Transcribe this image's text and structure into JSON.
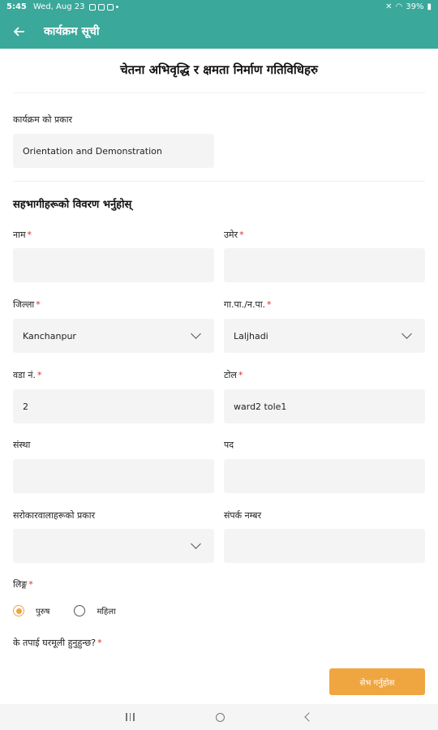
{
  "status_bar": {
    "time": "5:45",
    "date": "Wed, Aug 23",
    "battery": "39%"
  },
  "app_bar": {
    "title": "कार्यक्रम सूची"
  },
  "page": {
    "heading": "चेतना अभिवृद्धि र क्षमता निर्माण गतिविधिहरु"
  },
  "program_type": {
    "label": "कार्यक्रम को प्रकार",
    "value": "Orientation and Demonstration"
  },
  "section_title": "सहभागीहरूको विवरण भर्नुहोस्",
  "fields": {
    "name": {
      "label": "नाम",
      "value": ""
    },
    "age": {
      "label": "उमेर",
      "value": ""
    },
    "district": {
      "label": "जिल्ला",
      "value": "Kanchanpur"
    },
    "municipality": {
      "label": "गा.पा./न.पा.",
      "value": "Laljhadi"
    },
    "ward": {
      "label": "वडा नं.",
      "value": "2"
    },
    "tole": {
      "label": "टोल",
      "value": "ward2 tole1"
    },
    "organization": {
      "label": "संस्था",
      "value": ""
    },
    "position": {
      "label": "पद",
      "value": ""
    },
    "stakeholder_type": {
      "label": "सरोकारवालाहरूको प्रकार",
      "value": ""
    },
    "contact": {
      "label": "संपर्क नम्बर",
      "value": ""
    }
  },
  "gender": {
    "label": "लिङ्ग",
    "options": [
      "पुरुष",
      "महिला"
    ],
    "selected": "पुरुष"
  },
  "indigenous_question": {
    "label": "के तपाई घरमूली हुनुहुन्छ?"
  },
  "required_mark": "*",
  "save_button": {
    "label": "सेभ गर्नुहोस"
  },
  "colors": {
    "primary": "#3aa89a",
    "accent": "#f0a640",
    "required": "#d32f2f",
    "field_bg": "#f4f4f4"
  }
}
